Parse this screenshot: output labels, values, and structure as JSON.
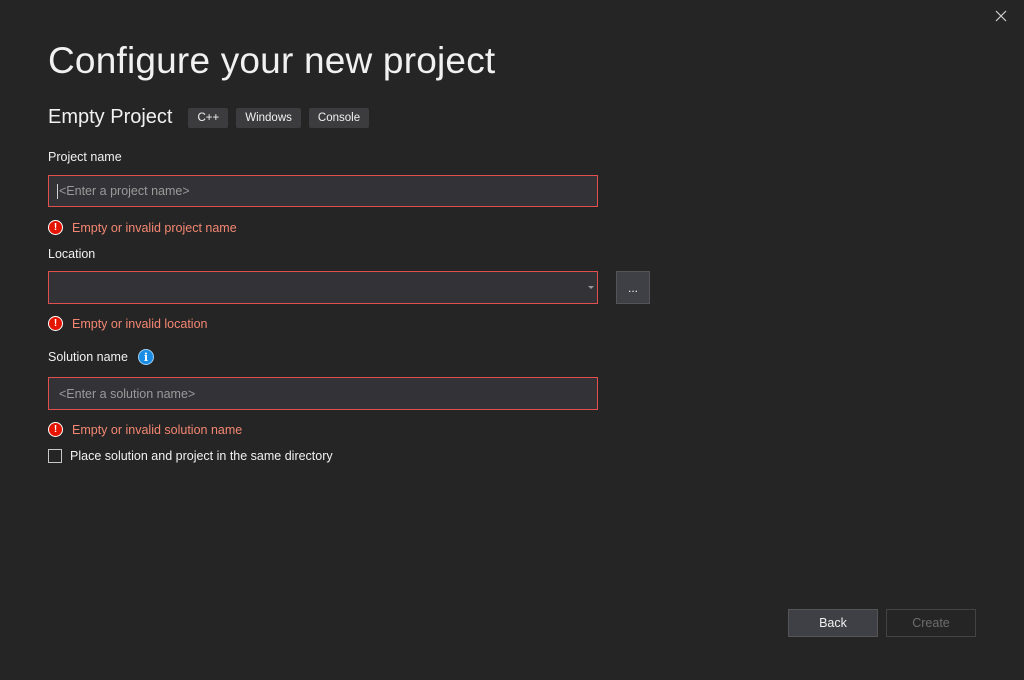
{
  "dialog": {
    "title": "Configure your new project",
    "template_name": "Empty Project",
    "tags": [
      "C++",
      "Windows",
      "Console"
    ]
  },
  "project_name": {
    "label": "Project name",
    "value": "",
    "placeholder": "<Enter a project name>",
    "error": "Empty or invalid project name"
  },
  "location": {
    "label": "Location",
    "value": "",
    "browse_label": "...",
    "error": "Empty or invalid location"
  },
  "solution_name": {
    "label": "Solution name",
    "info_glyph": "i",
    "value": "",
    "placeholder": "<Enter a solution name>",
    "error": "Empty or invalid solution name"
  },
  "same_directory": {
    "label": "Place solution and project in the same directory",
    "checked": false
  },
  "buttons": {
    "back": "Back",
    "create": "Create"
  },
  "icons": {
    "close": "close-icon",
    "error": "error-icon",
    "info": "info-icon",
    "dropdown": "chevron-down-icon"
  },
  "colors": {
    "background": "#252526",
    "field_background": "#333337",
    "error_border": "#e0504f",
    "error_text": "#f48771",
    "error_icon": "#e51400",
    "info_icon": "#1b8ce4"
  }
}
